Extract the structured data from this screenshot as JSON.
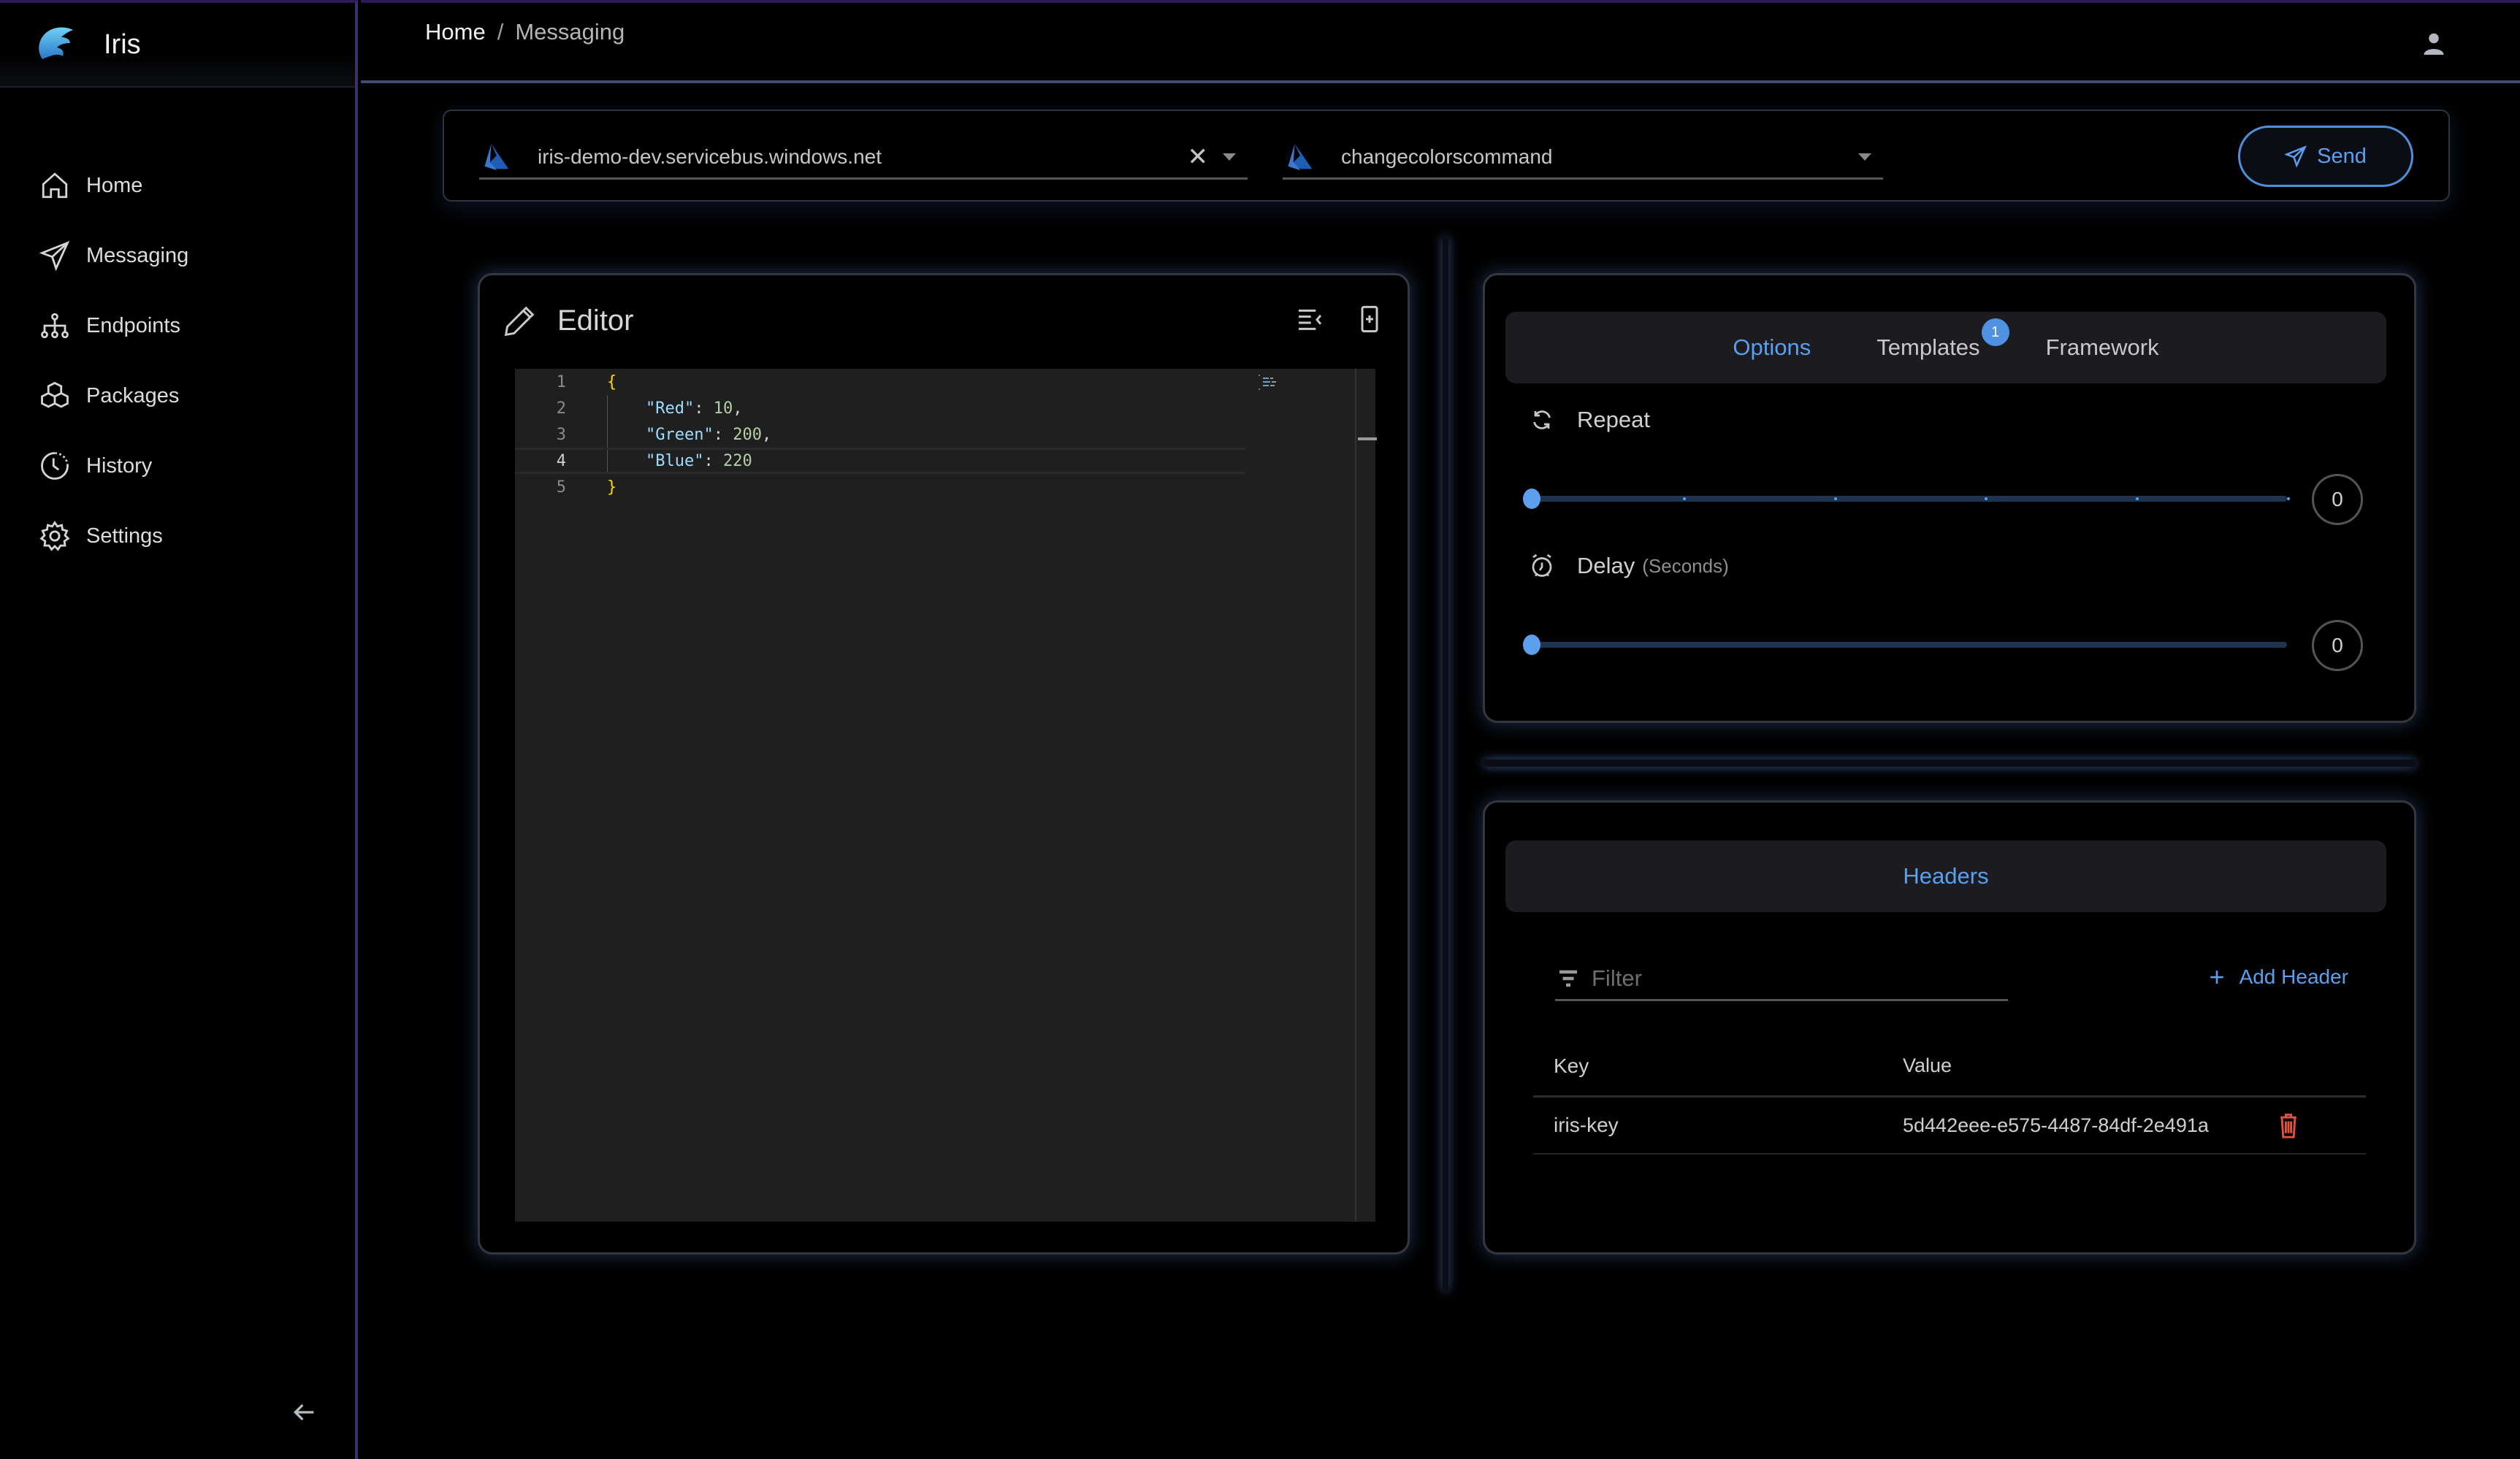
{
  "app": {
    "name": "Iris"
  },
  "sidebar": {
    "items": [
      {
        "label": "Home",
        "icon": "home-icon"
      },
      {
        "label": "Messaging",
        "icon": "send-icon"
      },
      {
        "label": "Endpoints",
        "icon": "network-icon"
      },
      {
        "label": "Packages",
        "icon": "packages-icon"
      },
      {
        "label": "History",
        "icon": "history-icon"
      },
      {
        "label": "Settings",
        "icon": "gear-icon"
      }
    ],
    "collapse_icon": "arrow-left-icon"
  },
  "header": {
    "breadcrumb": [
      {
        "label": "Home"
      },
      {
        "label": "Messaging"
      }
    ],
    "separator": "/",
    "user_icon": "user-icon"
  },
  "connection": {
    "namespace": {
      "value": "iris-demo-dev.servicebus.windows.net",
      "icon": "azure-icon",
      "clear_label": "✕"
    },
    "topic": {
      "value": "changecolorscommand",
      "icon": "azure-icon"
    },
    "send_label": "Send"
  },
  "editor": {
    "title": "Editor",
    "lines": [
      {
        "num": "1",
        "tokens": [
          {
            "t": "{",
            "c": "b"
          }
        ]
      },
      {
        "num": "2",
        "tokens": [
          {
            "t": "    ",
            "c": "p"
          },
          {
            "t": "\"Red\"",
            "c": "k"
          },
          {
            "t": ": ",
            "c": "p"
          },
          {
            "t": "10",
            "c": "n"
          },
          {
            "t": ",",
            "c": "p"
          }
        ]
      },
      {
        "num": "3",
        "tokens": [
          {
            "t": "    ",
            "c": "p"
          },
          {
            "t": "\"Green\"",
            "c": "k"
          },
          {
            "t": ": ",
            "c": "p"
          },
          {
            "t": "200",
            "c": "n"
          },
          {
            "t": ",",
            "c": "p"
          }
        ]
      },
      {
        "num": "4",
        "tokens": [
          {
            "t": "    ",
            "c": "p"
          },
          {
            "t": "\"Blue\"",
            "c": "k"
          },
          {
            "t": ": ",
            "c": "p"
          },
          {
            "t": "220",
            "c": "n"
          }
        ]
      },
      {
        "num": "5",
        "tokens": [
          {
            "t": "}",
            "c": "b"
          }
        ]
      }
    ],
    "active_line": 4
  },
  "options": {
    "tabs": [
      {
        "label": "Options",
        "active": true
      },
      {
        "label": "Templates",
        "badge": "1"
      },
      {
        "label": "Framework"
      }
    ],
    "repeat": {
      "label": "Repeat",
      "value": "0",
      "fraction": 0,
      "ticks": 5
    },
    "delay": {
      "label": "Delay",
      "unit": "(Seconds)",
      "value": "0",
      "fraction": 0
    }
  },
  "headers": {
    "tab_label": "Headers",
    "filter_placeholder": "Filter",
    "add_label": "Add Header",
    "columns": {
      "key": "Key",
      "value": "Value"
    },
    "rows": [
      {
        "key": "iris-key",
        "value": "5d442eee-e575-4487-84df-2e491a"
      }
    ]
  },
  "colors": {
    "accent": "#5aa0ee",
    "danger": "#e0533f",
    "sidebar_border": "#3e2f6a"
  }
}
